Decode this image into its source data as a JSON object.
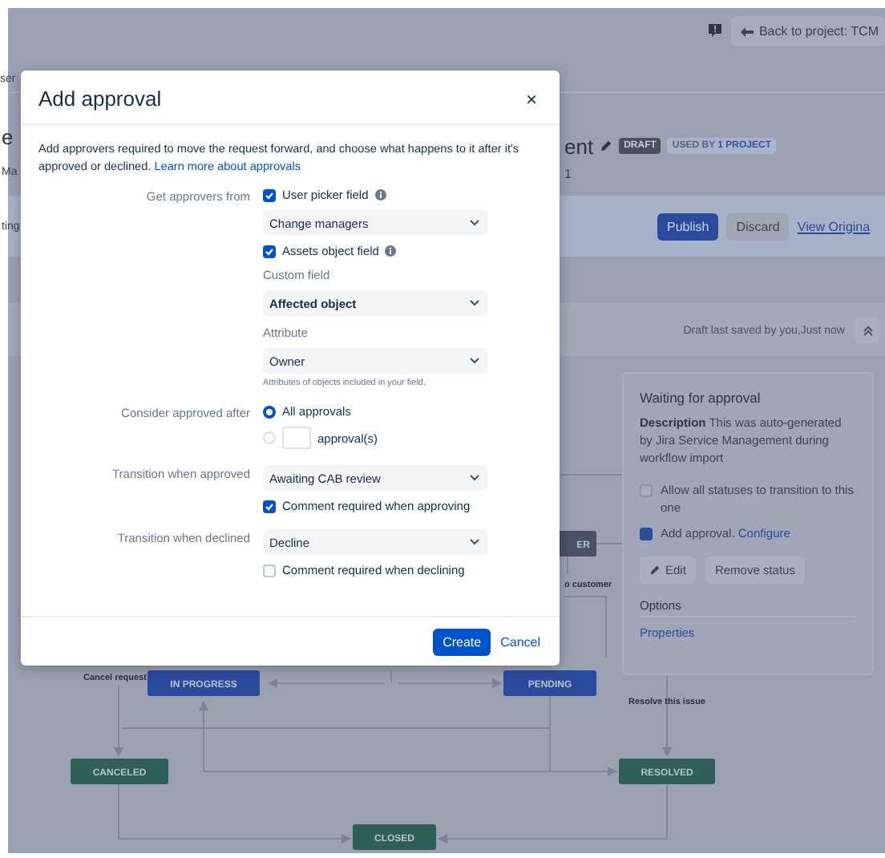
{
  "header": {
    "page_fragment": "ser",
    "back_button": "Back to project: TCM"
  },
  "workflow": {
    "title_fragments": [
      "e",
      "ent"
    ],
    "subtitle_fragments": [
      "Ma",
      "1"
    ],
    "badges": [
      {
        "label": "DRAFT",
        "kind": "dark"
      },
      {
        "label": "USED BY **1 PROJECT**",
        "kind": "light"
      }
    ]
  },
  "toolbar": {
    "fragment": "ting",
    "buttons": [
      {
        "label": "Publish",
        "kind": "primary"
      },
      {
        "label": "Discard",
        "kind": "default"
      },
      {
        "label": "View Origina",
        "kind": "link"
      }
    ]
  },
  "draft_bar": {
    "status": "Draft last saved by you,Just now"
  },
  "diagram": {
    "nodes": [
      {
        "label": "ER",
        "kind": "gray"
      },
      {
        "label": "IN PROGRESS",
        "kind": "blue"
      },
      {
        "label": "PENDING",
        "kind": "blue"
      },
      {
        "label": "CANCELED",
        "kind": "green"
      },
      {
        "label": "RESOLVED",
        "kind": "green"
      },
      {
        "label": "CLOSED",
        "kind": "green"
      }
    ],
    "transition_labels": [
      "o customer",
      "Cancel request",
      "Resolve this issue"
    ]
  },
  "status_panel": {
    "title": "Waiting for approval",
    "description": "**Description** This was auto-generated by Jira Service Management during workflow import",
    "options": [
      {
        "label": "Allow all statuses to transition to this one",
        "checked": false
      },
      {
        "label": "Add approval.",
        "checked": true,
        "link": "Configure"
      }
    ],
    "buttons": [
      {
        "label": "Edit",
        "kind": "edit"
      },
      {
        "label": "Remove status",
        "kind": "plain"
      }
    ],
    "section_title": "Options",
    "links": [
      "Properties"
    ]
  },
  "dialog": {
    "title": "Add approval",
    "close_label": "×",
    "description": "Add approvers required to move the request forward, and choose what happens to it after it's approved or declined.",
    "learn_more_link": "Learn more about approvals",
    "sections": [
      {
        "label": "Get approvers from",
        "controls": [
          {
            "kind": "checkbox",
            "label": "User picker field",
            "checked": true,
            "info": true
          },
          {
            "kind": "select",
            "value": "Change managers"
          },
          {
            "kind": "checkbox",
            "label": "Assets object field",
            "checked": true,
            "info": true
          },
          {
            "kind": "caption",
            "text": "Custom field"
          },
          {
            "kind": "select",
            "value": "Affected object"
          },
          {
            "kind": "caption",
            "text": "Attribute"
          },
          {
            "kind": "select",
            "value": "Owner"
          },
          {
            "kind": "hint",
            "text": "Attributes of objects included in your field."
          }
        ]
      },
      {
        "label": "Consider approved after",
        "controls": [
          {
            "kind": "radio",
            "label": "All approvals",
            "selected": true
          },
          {
            "kind": "radio_count",
            "suffix": "approval(s)",
            "selected": false
          }
        ]
      },
      {
        "label": "Transition when approved",
        "controls": [
          {
            "kind": "select",
            "value": "Awaiting CAB review"
          },
          {
            "kind": "checkbox",
            "label": "Comment required when approving",
            "checked": true,
            "info": false
          }
        ]
      },
      {
        "label": "Transition when declined",
        "controls": [
          {
            "kind": "select",
            "value": "Decline"
          },
          {
            "kind": "checkbox",
            "label": "Comment required when declining",
            "checked": false,
            "info": false
          }
        ]
      }
    ],
    "buttons": [
      {
        "label": "Create",
        "kind": "primary"
      },
      {
        "label": "Cancel",
        "kind": "link"
      }
    ]
  }
}
